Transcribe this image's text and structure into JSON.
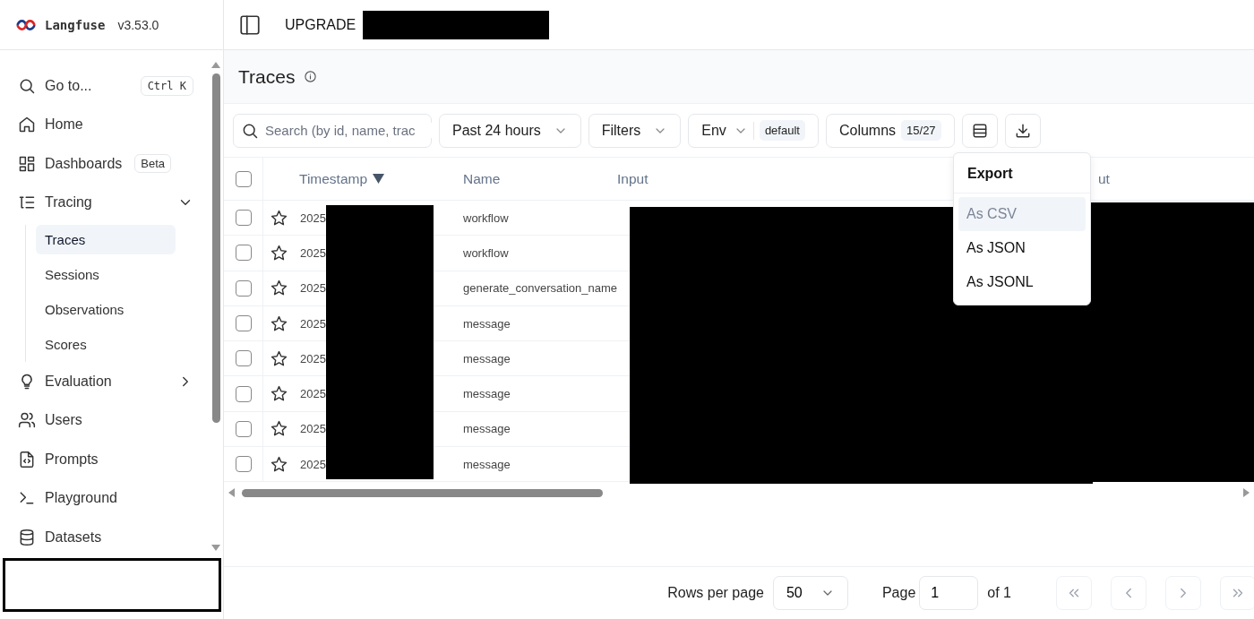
{
  "brand": {
    "name": "Langfuse",
    "version": "v3.53.0"
  },
  "topbar": {
    "upgrade": "UPGRADE"
  },
  "sidebar": {
    "goto": {
      "label": "Go to...",
      "shortcut": "Ctrl K"
    },
    "items": [
      {
        "label": "Home"
      },
      {
        "label": "Dashboards",
        "badge": "Beta"
      },
      {
        "label": "Tracing",
        "expanded": true,
        "children": [
          {
            "label": "Traces",
            "selected": true
          },
          {
            "label": "Sessions",
            "selected": false
          },
          {
            "label": "Observations",
            "selected": false
          },
          {
            "label": "Scores",
            "selected": false
          }
        ]
      },
      {
        "label": "Evaluation",
        "expanded": false
      },
      {
        "label": "Users"
      },
      {
        "label": "Prompts"
      },
      {
        "label": "Playground"
      },
      {
        "label": "Datasets"
      }
    ]
  },
  "page": {
    "title": "Traces"
  },
  "toolbar": {
    "search": {
      "placeholder": "Search (by id, name, trac"
    },
    "time_range": "Past 24 hours",
    "filters": "Filters",
    "env": {
      "label": "Env",
      "value": "default"
    },
    "columns": {
      "label": "Columns",
      "count": "15/27"
    }
  },
  "table": {
    "select_all": {
      "checked": false
    },
    "columns": [
      "Timestamp",
      "Name",
      "Input"
    ],
    "column_fragment": "ut",
    "rows": [
      {
        "checked": false,
        "starred": false,
        "timestamp": "2025",
        "name": "workflow"
      },
      {
        "checked": false,
        "starred": false,
        "timestamp": "2025",
        "name": "workflow"
      },
      {
        "checked": false,
        "starred": false,
        "timestamp": "2025",
        "name": "generate_conversation_name"
      },
      {
        "checked": false,
        "starred": false,
        "timestamp": "2025",
        "name": "message"
      },
      {
        "checked": false,
        "starred": false,
        "timestamp": "2025",
        "name": "message"
      },
      {
        "checked": false,
        "starred": false,
        "timestamp": "2025",
        "name": "message"
      },
      {
        "checked": false,
        "starred": false,
        "timestamp": "2025",
        "name": "message"
      },
      {
        "checked": false,
        "starred": false,
        "timestamp": "2025",
        "name": "message"
      }
    ]
  },
  "export_menu": {
    "title": "Export",
    "items": [
      {
        "label": "As CSV",
        "highlighted": true
      },
      {
        "label": "As JSON",
        "highlighted": false
      },
      {
        "label": "As JSONL",
        "highlighted": false
      }
    ]
  },
  "footer": {
    "rows_per_page_label": "Rows per page",
    "rows_per_page": "50",
    "page_label": "Page",
    "page": "1",
    "page_total": "of 1",
    "pager_buttons": [
      {
        "kind": "first",
        "disabled": true
      },
      {
        "kind": "prev",
        "disabled": true
      },
      {
        "kind": "next",
        "disabled": true
      },
      {
        "kind": "last",
        "disabled": true
      }
    ]
  }
}
